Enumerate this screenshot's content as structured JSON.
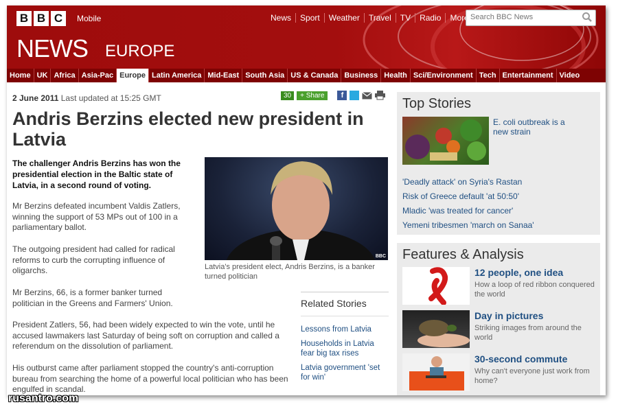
{
  "header": {
    "logo_letters": [
      "B",
      "B",
      "C"
    ],
    "mobile_label": "Mobile",
    "top_nav": [
      "News",
      "Sport",
      "Weather",
      "Travel",
      "TV",
      "Radio",
      "More"
    ],
    "search_placeholder": "Search BBC News",
    "site_title": "NEWS",
    "section_title": "EUROPE"
  },
  "main_nav": [
    {
      "label": "Home",
      "active": false
    },
    {
      "label": "UK",
      "active": false
    },
    {
      "label": "Africa",
      "active": false
    },
    {
      "label": "Asia-Pac",
      "active": false
    },
    {
      "label": "Europe",
      "active": true
    },
    {
      "label": "Latin America",
      "active": false
    },
    {
      "label": "Mid-East",
      "active": false
    },
    {
      "label": "South Asia",
      "active": false
    },
    {
      "label": "US & Canada",
      "active": false
    },
    {
      "label": "Business",
      "active": false
    },
    {
      "label": "Health",
      "active": false
    },
    {
      "label": "Sci/Environment",
      "active": false
    },
    {
      "label": "Tech",
      "active": false
    },
    {
      "label": "Entertainment",
      "active": false
    },
    {
      "label": "Video",
      "active": false
    }
  ],
  "article": {
    "date": "2 June 2011",
    "updated": "Last updated at 15:25 GMT",
    "share_count": "30",
    "share_label": "Share",
    "headline": "Andris Berzins elected new president in Latvia",
    "intro": "The challenger Andris Berzins has won the presidential election in the Baltic state of Latvia, in a second round of voting.",
    "paragraphs": [
      "Mr Berzins defeated incumbent Valdis Zatlers, winning the support of 53 MPs out of 100 in a parliamentary ballot.",
      "The outgoing president had called for radical reforms to curb the corrupting influence of oligarchs.",
      "Mr Berzins, 66, is a former banker turned politician in the Greens and Farmers' Union.",
      "President Zatlers, 56, had been widely expected to win the vote, until he accused lawmakers last Saturday of being soft on corruption and called a referendum on the dissolution of parliament.",
      "His outburst came after parliament stopped the country's anti-corruption bureau from searching the home of a powerful local politician who has been engulfed in scandal."
    ],
    "photo_credit": "BBC",
    "photo_caption": "Latvia's president elect, Andris Berzins, is a banker turned politician",
    "related_title": "Related Stories",
    "related": [
      "Lessons from Latvia",
      "Households in Latvia fear big tax rises",
      "Latvia government 'set for win'"
    ]
  },
  "top_stories": {
    "title": "Top Stories",
    "lead": "E. coli outbreak is a new strain",
    "links": [
      "'Deadly attack' on Syria's Rastan",
      "Risk of Greece default 'at 50:50'",
      "Mladic 'was treated for cancer'",
      "Yemeni tribesmen 'march on Sanaa'"
    ]
  },
  "features": {
    "title": "Features & Analysis",
    "items": [
      {
        "title": "12 people, one idea",
        "desc": "How a loop of red ribbon conquered the world"
      },
      {
        "title": "Day in pictures",
        "desc": "Striking images from around the world"
      },
      {
        "title": "30-second commute",
        "desc": "Why can't everyone just work from home?"
      }
    ]
  },
  "watermark": "rusantro.com",
  "colors": {
    "brand_red": "#a30e0e",
    "nav_dark": "#7e0303",
    "link_blue": "#1f4f82"
  }
}
